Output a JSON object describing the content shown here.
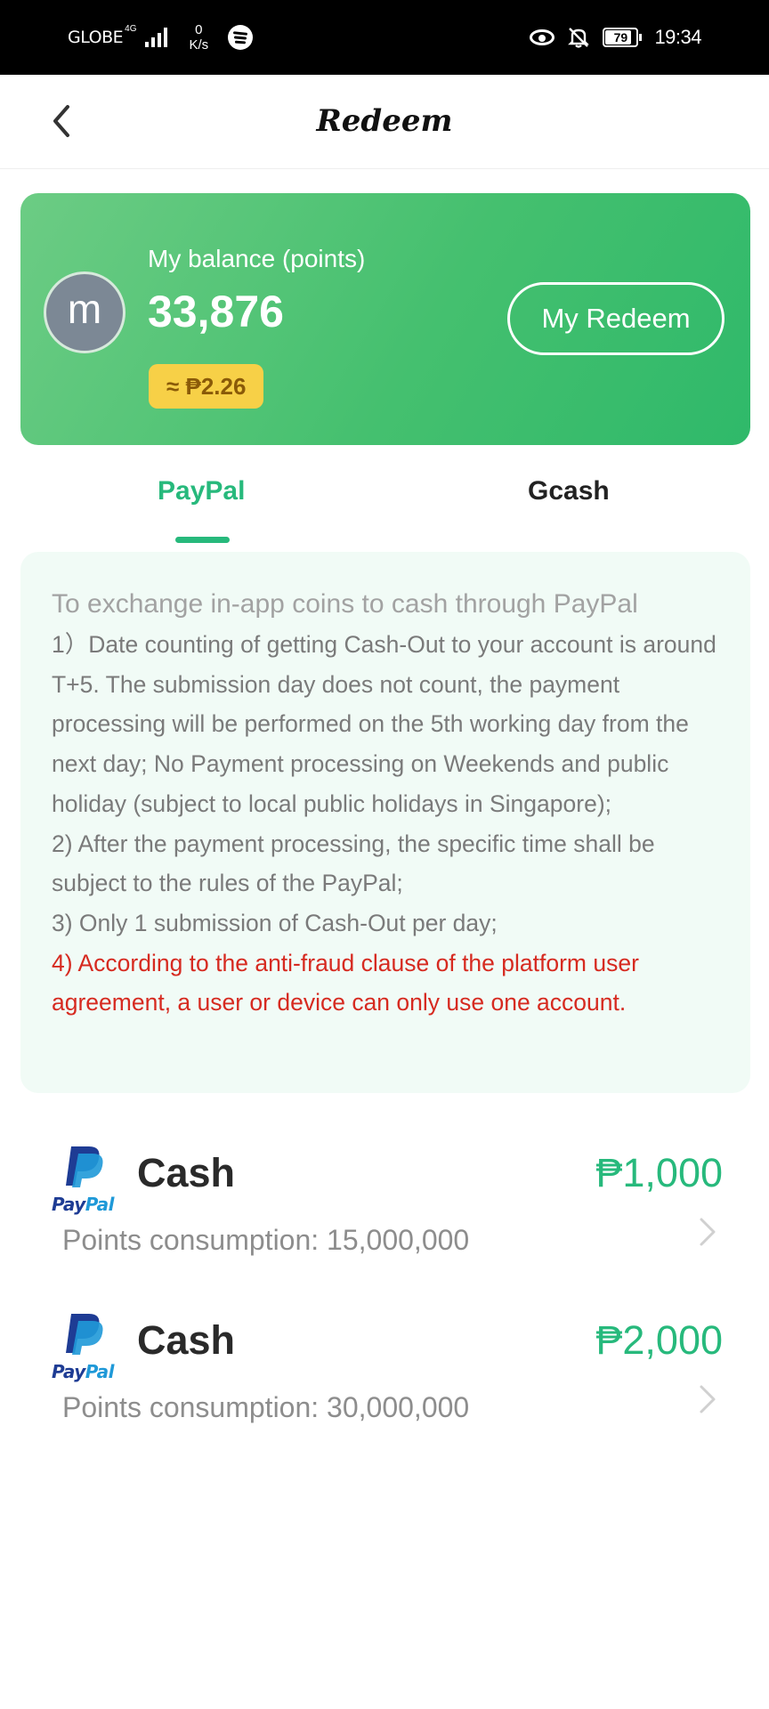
{
  "status_bar": {
    "carrier": "GLOBE",
    "network": "4G",
    "speed_value": "0",
    "speed_unit": "K/s",
    "battery": "79",
    "time": "19:34"
  },
  "header": {
    "title": "Redeem"
  },
  "balance": {
    "avatar_letter": "m",
    "label": "My balance (points)",
    "value": "33,876",
    "peso_equivalent": "≈ ₱2.26",
    "my_redeem_label": "My Redeem"
  },
  "tabs": [
    {
      "label": "PayPal",
      "active": true
    },
    {
      "label": "Gcash",
      "active": false
    }
  ],
  "info": {
    "lead": "To exchange in-app coins to cash through PayPal",
    "rule1": "1）Date counting of getting Cash-Out to your account is around T+5. The submission day does not count, the payment processing will be performed on the 5th working day from the next day; No Payment processing on Weekends and public holiday (subject to local public holidays in Singapore);",
    "rule2": "2) After the payment processing, the specific time shall be subject to the rules of the PayPal;",
    "rule3": "3) Only 1 submission of Cash-Out per day;",
    "rule4": "4) According to the anti-fraud clause of the platform user agreement, a user or device can only use one account."
  },
  "options": [
    {
      "logo_text_1": "Pay",
      "logo_text_2": "Pal",
      "title": "Cash",
      "amount": "₱1,000",
      "points": "Points consumption: 15,000,000"
    },
    {
      "logo_text_1": "Pay",
      "logo_text_2": "Pal",
      "title": "Cash",
      "amount": "₱2,000",
      "points": "Points consumption: 30,000,000"
    }
  ],
  "colors": {
    "accent_green": "#27b97c",
    "card_green": "#45c06f",
    "warning_red": "#d62a20",
    "pill_yellow": "#f7d047"
  },
  "icons": [
    "back-arrow-icon",
    "eye-icon",
    "bell-off-icon",
    "battery-icon",
    "spotify-icon",
    "signal-icon",
    "paypal-logo-icon",
    "chevron-right-icon"
  ]
}
